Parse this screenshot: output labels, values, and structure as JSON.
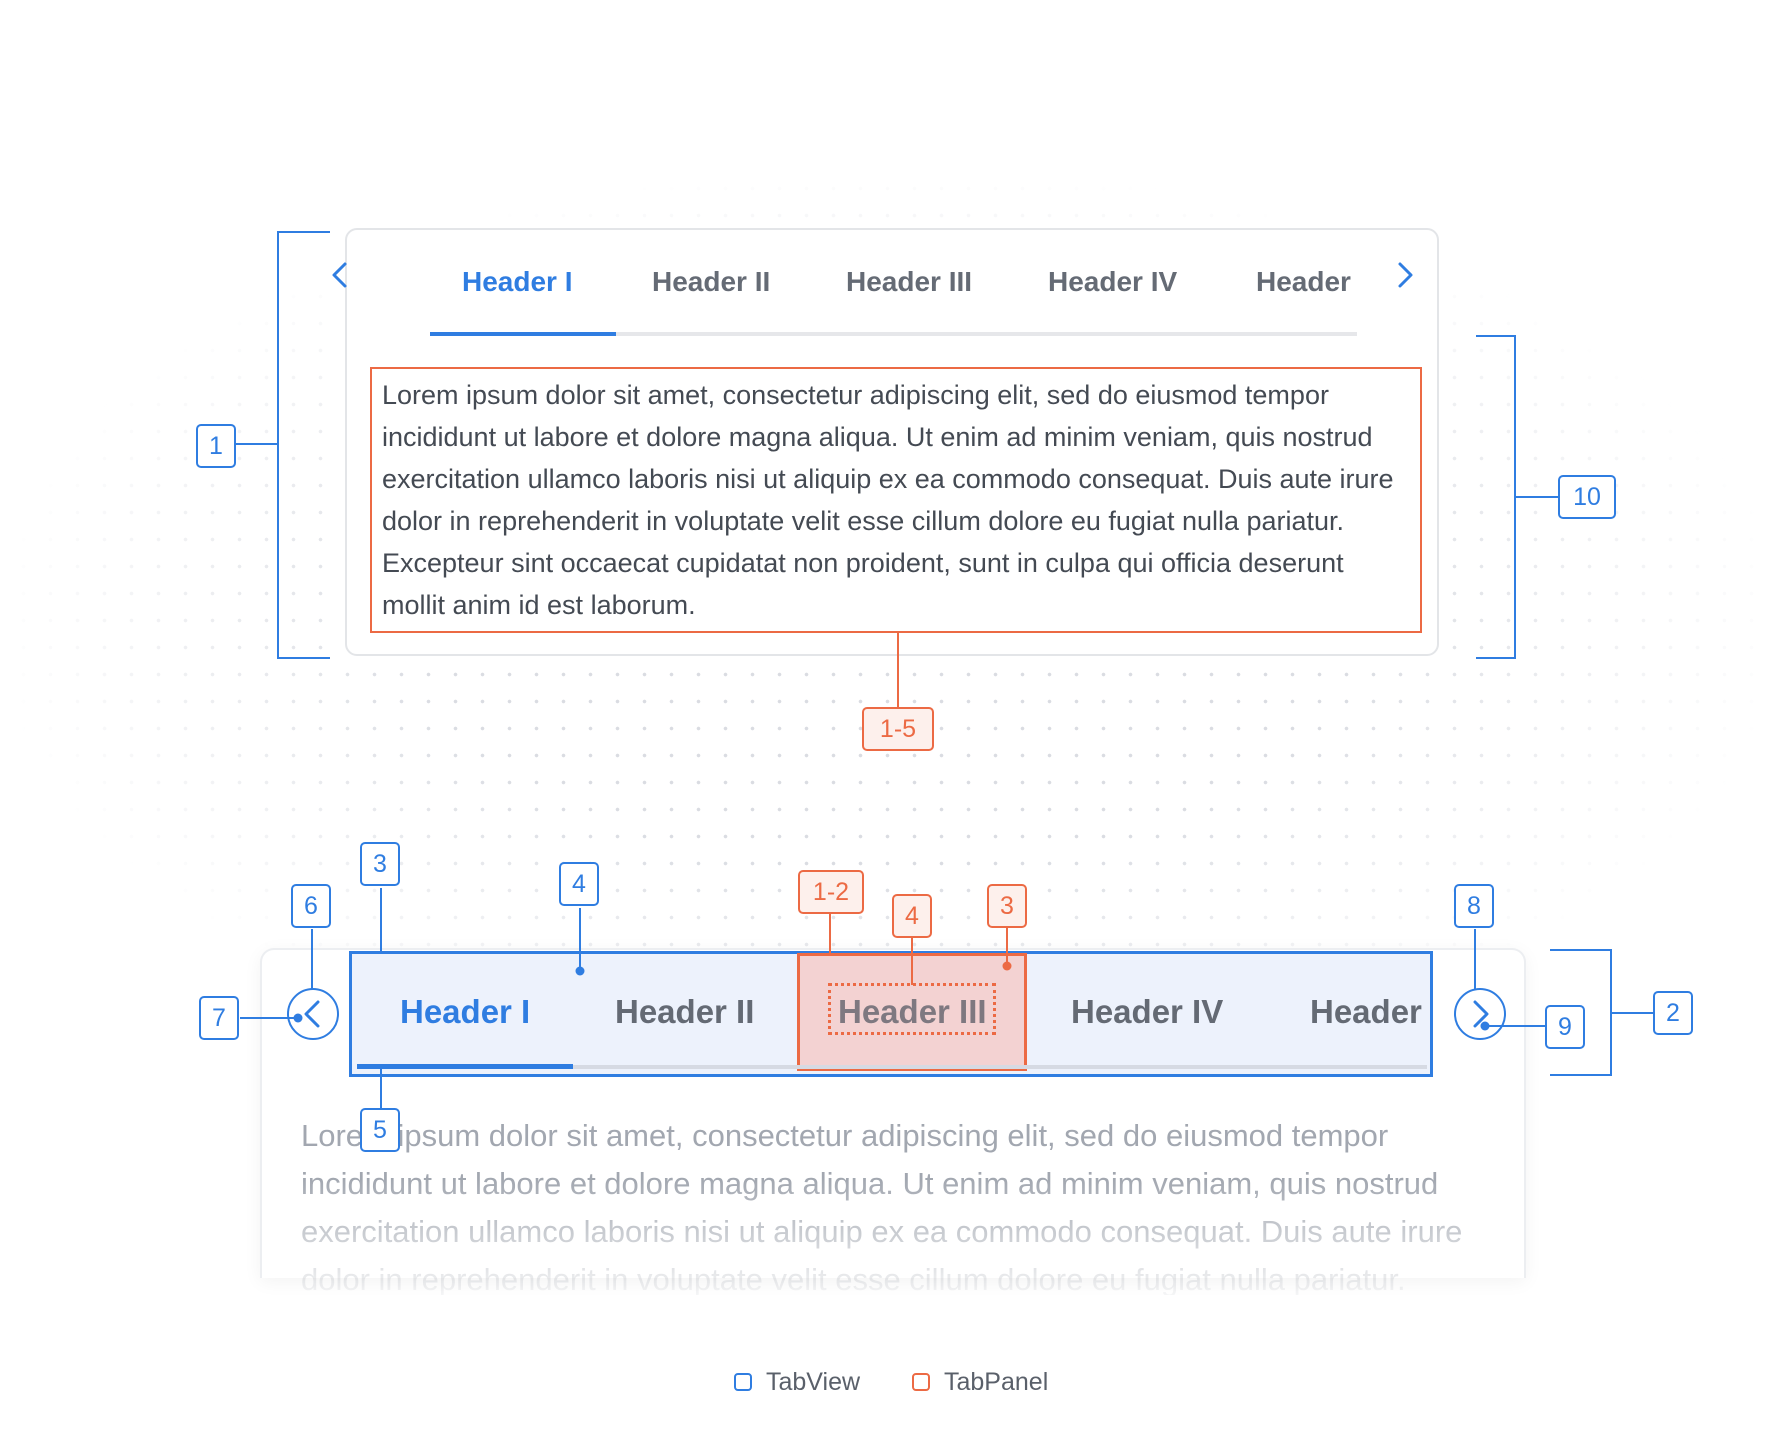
{
  "tabview_demo": {
    "tabs": [
      {
        "label": "Header I",
        "active": true
      },
      {
        "label": "Header II",
        "active": false
      },
      {
        "label": "Header III",
        "active": false
      },
      {
        "label": "Header IV",
        "active": false
      },
      {
        "label": "Header",
        "active": false
      }
    ],
    "prev_icon": "chevron-left-icon",
    "next_icon": "chevron-right-icon",
    "panel_text": "Lorem ipsum dolor sit amet, consectetur adipiscing elit, sed do eiusmod tempor incididunt ut labore et dolore magna aliqua. Ut enim ad minim veniam, quis nostrud exercitation ullamco laboris nisi ut aliquip ex ea commodo consequat. Duis aute irure dolor in reprehenderit in voluptate velit esse cillum dolore eu fugiat nulla pariatur. Excepteur sint occaecat cupidatat non proident, sunt in culpa qui officia deserunt mollit anim id est laborum."
  },
  "callouts": {
    "c1": "1",
    "c10": "10",
    "c1_5": "1-5",
    "c3": "3",
    "c4": "4",
    "c6": "6",
    "c7": "7",
    "c5": "5",
    "c8": "8",
    "c9": "9",
    "c2": "2",
    "o1_2": "1-2",
    "o4": "4",
    "o3": "3"
  },
  "legend": {
    "tabview": "TabView",
    "tabpanel": "TabPanel"
  },
  "colors": {
    "tabview": "#2f7de1",
    "tabpanel": "#ec6a44",
    "text": "#444a53",
    "muted": "#a2a7b0"
  }
}
